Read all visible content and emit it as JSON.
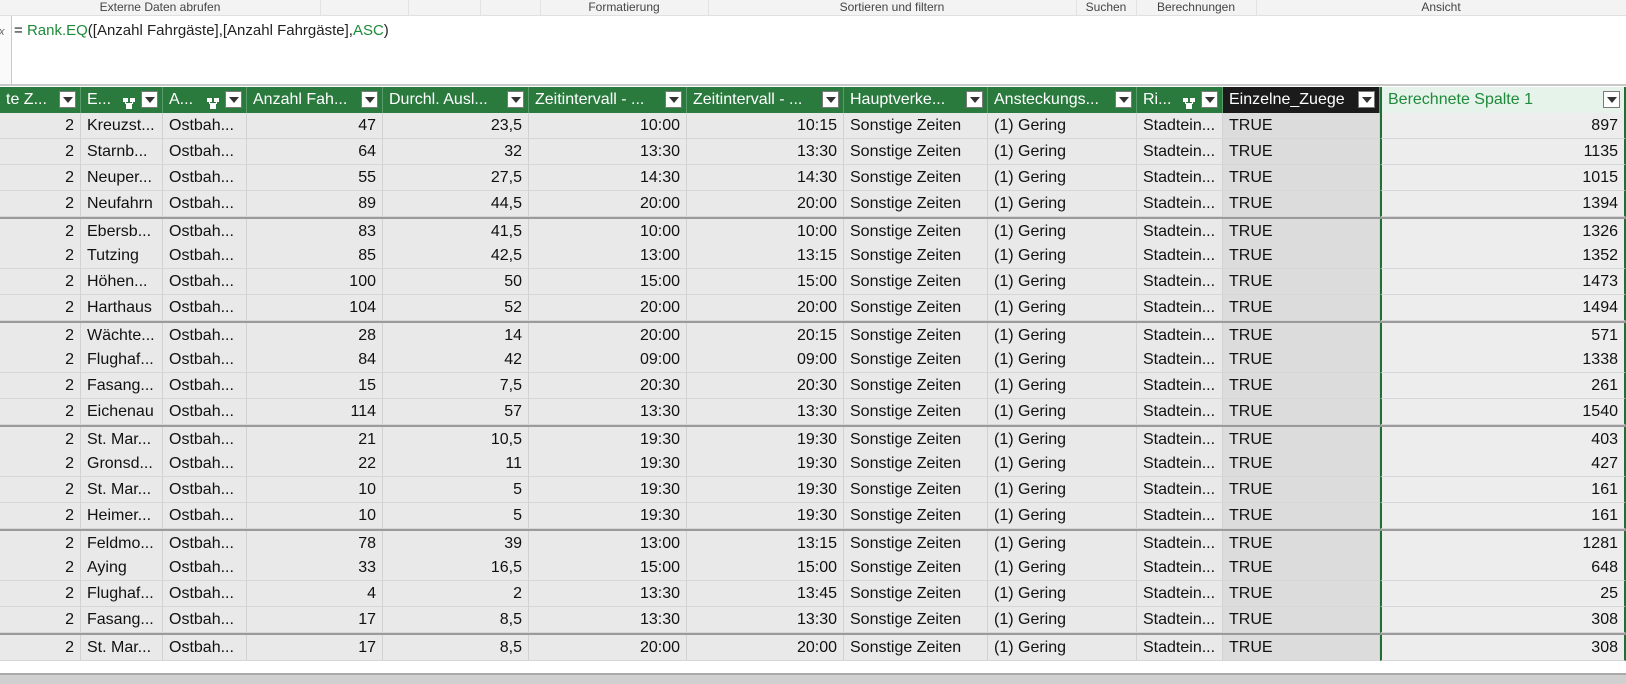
{
  "ribbon": {
    "groups": [
      "Externe Daten abrufen",
      "",
      "",
      "",
      "Formatierung",
      "Sortieren und filtern",
      "Suchen",
      "Berechnungen",
      "Ansicht"
    ]
  },
  "formula_bar": {
    "gutter_icon": "fx-icon",
    "gutter_text": "x",
    "prefix": "= ",
    "function": "Rank.EQ",
    "open_paren": "(",
    "arguments": "[Anzahl Fahrgäste],[Anzahl Fahrgäste],",
    "keyword": "ASC",
    "close_paren": ")"
  },
  "table": {
    "columns": [
      {
        "label": "te Z...",
        "relationship_icon": false,
        "dropdown": true
      },
      {
        "label": "E...",
        "relationship_icon": true,
        "dropdown": true
      },
      {
        "label": "A...",
        "relationship_icon": true,
        "dropdown": true
      },
      {
        "label": "Anzahl Fah...",
        "relationship_icon": false,
        "dropdown": true
      },
      {
        "label": "Durchl. Ausl...",
        "relationship_icon": false,
        "dropdown": true
      },
      {
        "label": "Zeitintervall - ...",
        "relationship_icon": false,
        "dropdown": true
      },
      {
        "label": "Zeitintervall - ...",
        "relationship_icon": false,
        "dropdown": true
      },
      {
        "label": "Hauptverke...",
        "relationship_icon": false,
        "dropdown": true
      },
      {
        "label": "Ansteckungs...",
        "relationship_icon": false,
        "dropdown": true
      },
      {
        "label": "Ri...",
        "relationship_icon": true,
        "dropdown": true
      },
      {
        "label": "Einzelne_Zuege",
        "relationship_icon": false,
        "dropdown": true
      },
      {
        "label": "Berechnete Spalte 1",
        "relationship_icon": false,
        "dropdown": true
      }
    ],
    "rows": [
      [
        "2",
        "Kreuzst...",
        "Ostbah...",
        "47",
        "23,5",
        "10:00",
        "10:15",
        "Sonstige Zeiten",
        "(1) Gering",
        "Stadtein...",
        "TRUE",
        "897"
      ],
      [
        "2",
        "Starnb...",
        "Ostbah...",
        "64",
        "32",
        "13:30",
        "13:30",
        "Sonstige Zeiten",
        "(1) Gering",
        "Stadtein...",
        "TRUE",
        "1135"
      ],
      [
        "2",
        "Neuper...",
        "Ostbah...",
        "55",
        "27,5",
        "14:30",
        "14:30",
        "Sonstige Zeiten",
        "(1) Gering",
        "Stadtein...",
        "TRUE",
        "1015"
      ],
      [
        "2",
        "Neufahrn",
        "Ostbah...",
        "89",
        "44,5",
        "20:00",
        "20:00",
        "Sonstige Zeiten",
        "(1) Gering",
        "Stadtein...",
        "TRUE",
        "1394"
      ],
      [
        "2",
        "Ebersb...",
        "Ostbah...",
        "83",
        "41,5",
        "10:00",
        "10:00",
        "Sonstige Zeiten",
        "(1) Gering",
        "Stadtein...",
        "TRUE",
        "1326"
      ],
      [
        "2",
        "Tutzing",
        "Ostbah...",
        "85",
        "42,5",
        "13:00",
        "13:15",
        "Sonstige Zeiten",
        "(1) Gering",
        "Stadtein...",
        "TRUE",
        "1352"
      ],
      [
        "2",
        "Höhen...",
        "Ostbah...",
        "100",
        "50",
        "15:00",
        "15:00",
        "Sonstige Zeiten",
        "(1) Gering",
        "Stadtein...",
        "TRUE",
        "1473"
      ],
      [
        "2",
        "Harthaus",
        "Ostbah...",
        "104",
        "52",
        "20:00",
        "20:00",
        "Sonstige Zeiten",
        "(1) Gering",
        "Stadtein...",
        "TRUE",
        "1494"
      ],
      [
        "2",
        "Wächte...",
        "Ostbah...",
        "28",
        "14",
        "20:00",
        "20:15",
        "Sonstige Zeiten",
        "(1) Gering",
        "Stadtein...",
        "TRUE",
        "571"
      ],
      [
        "2",
        "Flughaf...",
        "Ostbah...",
        "84",
        "42",
        "09:00",
        "09:00",
        "Sonstige Zeiten",
        "(1) Gering",
        "Stadtein...",
        "TRUE",
        "1338"
      ],
      [
        "2",
        "Fasang...",
        "Ostbah...",
        "15",
        "7,5",
        "20:30",
        "20:30",
        "Sonstige Zeiten",
        "(1) Gering",
        "Stadtein...",
        "TRUE",
        "261"
      ],
      [
        "2",
        "Eichenau",
        "Ostbah...",
        "114",
        "57",
        "13:30",
        "13:30",
        "Sonstige Zeiten",
        "(1) Gering",
        "Stadtein...",
        "TRUE",
        "1540"
      ],
      [
        "2",
        "St. Mar...",
        "Ostbah...",
        "21",
        "10,5",
        "19:30",
        "19:30",
        "Sonstige Zeiten",
        "(1) Gering",
        "Stadtein...",
        "TRUE",
        "403"
      ],
      [
        "2",
        "Gronsd...",
        "Ostbah...",
        "22",
        "11",
        "19:30",
        "19:30",
        "Sonstige Zeiten",
        "(1) Gering",
        "Stadtein...",
        "TRUE",
        "427"
      ],
      [
        "2",
        "St. Mar...",
        "Ostbah...",
        "10",
        "5",
        "19:30",
        "19:30",
        "Sonstige Zeiten",
        "(1) Gering",
        "Stadtein...",
        "TRUE",
        "161"
      ],
      [
        "2",
        "Heimer...",
        "Ostbah...",
        "10",
        "5",
        "19:30",
        "19:30",
        "Sonstige Zeiten",
        "(1) Gering",
        "Stadtein...",
        "TRUE",
        "161"
      ],
      [
        "2",
        "Feldmo...",
        "Ostbah...",
        "78",
        "39",
        "13:00",
        "13:15",
        "Sonstige Zeiten",
        "(1) Gering",
        "Stadtein...",
        "TRUE",
        "1281"
      ],
      [
        "2",
        "Aying",
        "Ostbah...",
        "33",
        "16,5",
        "15:00",
        "15:00",
        "Sonstige Zeiten",
        "(1) Gering",
        "Stadtein...",
        "TRUE",
        "648"
      ],
      [
        "2",
        "Flughaf...",
        "Ostbah...",
        "4",
        "2",
        "13:30",
        "13:45",
        "Sonstige Zeiten",
        "(1) Gering",
        "Stadtein...",
        "TRUE",
        "25"
      ],
      [
        "2",
        "Fasang...",
        "Ostbah...",
        "17",
        "8,5",
        "13:30",
        "13:30",
        "Sonstige Zeiten",
        "(1) Gering",
        "Stadtein...",
        "TRUE",
        "308"
      ],
      [
        "2",
        "St. Mar...",
        "Ostbah...",
        "17",
        "8,5",
        "20:00",
        "20:00",
        "Sonstige Zeiten",
        "(1) Gering",
        "Stadtein...",
        "TRUE",
        "308"
      ]
    ],
    "numeric_columns": [
      0,
      3,
      4,
      5,
      6,
      11
    ],
    "group_separator_before_rows": [
      4,
      8,
      12,
      16,
      20
    ]
  }
}
